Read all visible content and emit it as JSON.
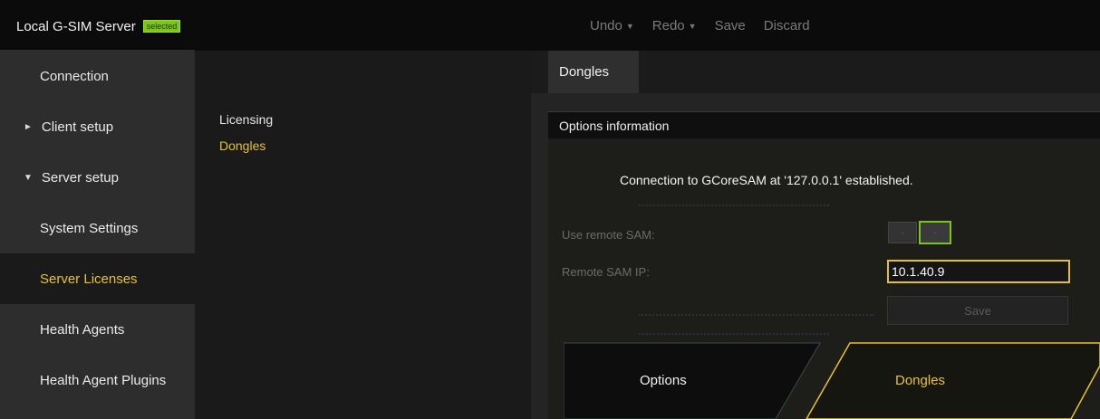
{
  "header": {
    "server_title": "Local G-SIM Server",
    "badge": "selected",
    "menu": [
      {
        "label": "Undo",
        "caret": "▼"
      },
      {
        "label": "Redo",
        "caret": "▼"
      },
      {
        "label": "Save",
        "caret": ""
      },
      {
        "label": "Discard",
        "caret": ""
      }
    ]
  },
  "nav": {
    "connection": "Connection",
    "client_setup": "Client setup",
    "server_setup": "Server setup",
    "system_settings": "System Settings",
    "server_licenses": "Server Licenses",
    "health_agents": "Health Agents",
    "health_agent_plugins": "Health Agent Plugins",
    "collapsed_arrow": "►",
    "expanded_arrow": "▼"
  },
  "subnav": {
    "licensing": "Licensing",
    "dongles": "Dongles"
  },
  "panel": {
    "tab": "Dongles",
    "section_title": "Options information",
    "status": "Connection to GCoreSAM at '127.0.0.1' established.",
    "use_remote_label": "Use remote SAM:",
    "remote_ip_label": "Remote SAM IP:",
    "remote_ip_value": "10.1.40.9",
    "save_label": "Save",
    "toggle_off_glyph": "·",
    "toggle_on_glyph": "·",
    "tiles": {
      "options": "Options",
      "dongles": "Dongles"
    }
  },
  "colors": {
    "accent_yellow": "#e9c12b",
    "accent_green": "#79c51a",
    "badge_green": "#7fc31f"
  }
}
